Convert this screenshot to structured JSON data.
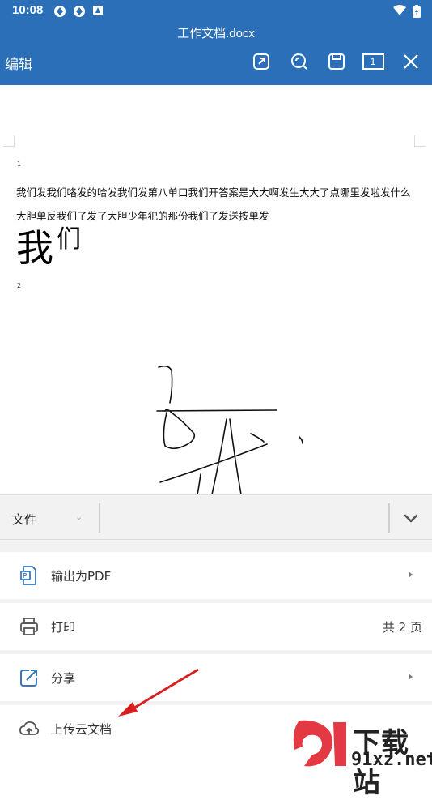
{
  "status_bar": {
    "time": "10:08"
  },
  "app_bar": {
    "title": "工作文档.docx",
    "mode_label": "编辑",
    "page_indicator": "1",
    "tools": [
      "share-out-icon",
      "search-icon",
      "save-icon",
      "page-count-icon",
      "close-icon"
    ]
  },
  "document": {
    "page1_number": "1",
    "line1": "我们发我们咯发的哈发我们发第八单口我们开答案是大大啊发生大大了点哪里发啦发什么",
    "line2": "大胆单反我们了发了大胆少年犯的那份我们了发送按单发",
    "big_char1": "我",
    "big_char2": "们",
    "page2_number": "2"
  },
  "sheet": {
    "tab_label": "文件",
    "items": [
      {
        "label": "输出为PDF",
        "icon": "pdf-icon"
      },
      {
        "label": "打印",
        "icon": "printer-icon",
        "value": "共 2 页"
      },
      {
        "label": "分享",
        "icon": "share-icon"
      },
      {
        "label": "上传云文档",
        "icon": "cloud-upload-icon"
      }
    ]
  },
  "watermark": {
    "text1": "下载站",
    "text2": "91xz.net"
  },
  "colors": {
    "brand": "#2b6fb8",
    "annotation": "#d81e1e"
  }
}
